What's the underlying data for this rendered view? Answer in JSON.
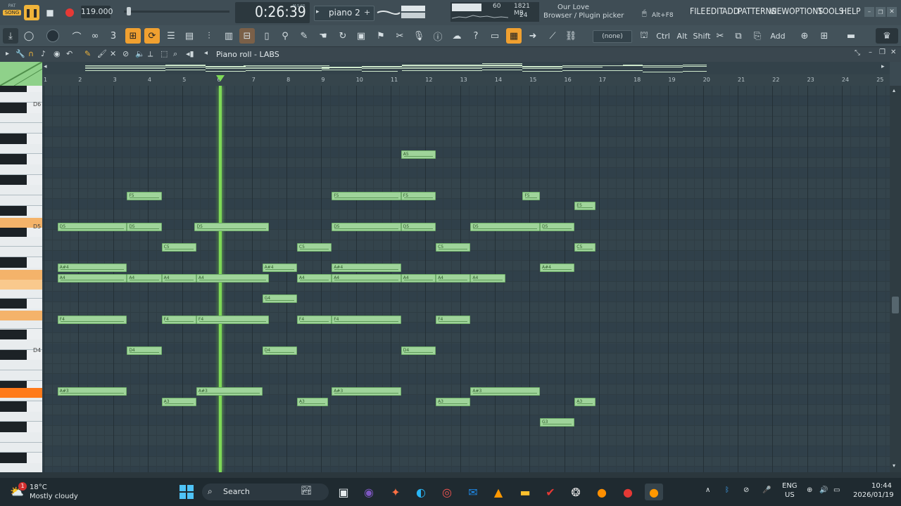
{
  "transport": {
    "song_label": "SONG",
    "pat_label": "PAT",
    "tempo": "119.000",
    "time": "0:26:39",
    "time_unit": "M:S:CS",
    "pattern_name": "piano 2",
    "cpu": "60",
    "memory": "1821 MB",
    "polyphony": "24"
  },
  "hint": {
    "line1": "Our Love",
    "line2": "Browser / Plugin picker",
    "shortcut": "Alt+F8"
  },
  "menu": [
    "FILE",
    "EDIT",
    "ADD",
    "PATTERNS",
    "VIEW",
    "OPTIONS",
    "TOOLS",
    "HELP"
  ],
  "toolbar2": {
    "channel_select": "(none)",
    "modifier_keys": [
      "Ctrl",
      "Alt",
      "Shift"
    ],
    "add_label": "Add"
  },
  "piano_roll": {
    "title": "Piano roll - LABS",
    "bars": [
      "1",
      "2",
      "3",
      "4",
      "5",
      "6",
      "7",
      "8",
      "9",
      "10",
      "11",
      "12",
      "13",
      "14",
      "15",
      "16",
      "17",
      "18",
      "19",
      "20",
      "21",
      "22",
      "23",
      "24",
      "25"
    ],
    "key_labels": [
      "D6",
      "D5",
      "D4"
    ],
    "playhead_bar": 6.05,
    "notes": [
      {
        "pitch": "A5",
        "start": 11.3,
        "len": 1.0,
        "row": 0
      },
      {
        "pitch": "F5",
        "start": 3.4,
        "len": 1.0,
        "row": 1
      },
      {
        "pitch": "F5",
        "start": 9.3,
        "len": 2.0,
        "row": 1
      },
      {
        "pitch": "F5",
        "start": 11.3,
        "len": 1.0,
        "row": 1
      },
      {
        "pitch": "F5",
        "start": 14.8,
        "len": 0.5,
        "row": 1
      },
      {
        "pitch": "E5",
        "start": 16.3,
        "len": 0.6,
        "row": 2
      },
      {
        "pitch": "D5",
        "start": 1.4,
        "len": 2.0,
        "row": 3
      },
      {
        "pitch": "D5",
        "start": 3.4,
        "len": 1.0,
        "row": 3
      },
      {
        "pitch": "D5",
        "start": 5.35,
        "len": 2.15,
        "row": 3
      },
      {
        "pitch": "D5",
        "start": 9.3,
        "len": 2.0,
        "row": 3
      },
      {
        "pitch": "D5",
        "start": 11.3,
        "len": 1.0,
        "row": 3
      },
      {
        "pitch": "D5",
        "start": 13.3,
        "len": 2.0,
        "row": 3
      },
      {
        "pitch": "D5",
        "start": 15.3,
        "len": 1.0,
        "row": 3
      },
      {
        "pitch": "C5",
        "start": 4.4,
        "len": 1.0,
        "row": 4
      },
      {
        "pitch": "C5",
        "start": 8.3,
        "len": 1.0,
        "row": 4
      },
      {
        "pitch": "C5",
        "start": 12.3,
        "len": 1.0,
        "row": 4
      },
      {
        "pitch": "C5",
        "start": 16.3,
        "len": 0.6,
        "row": 4
      },
      {
        "pitch": "A#4",
        "start": 1.4,
        "len": 2.0,
        "row": 5
      },
      {
        "pitch": "A#4",
        "start": 7.3,
        "len": 1.0,
        "row": 5
      },
      {
        "pitch": "A#4",
        "start": 9.3,
        "len": 2.0,
        "row": 5
      },
      {
        "pitch": "A#4",
        "start": 15.3,
        "len": 1.0,
        "row": 5
      },
      {
        "pitch": "A4",
        "start": 1.4,
        "len": 2.0,
        "row": 6
      },
      {
        "pitch": "A4",
        "start": 3.4,
        "len": 1.0,
        "row": 6
      },
      {
        "pitch": "A4",
        "start": 4.4,
        "len": 1.0,
        "row": 6
      },
      {
        "pitch": "A4",
        "start": 5.4,
        "len": 2.1,
        "row": 6
      },
      {
        "pitch": "A4",
        "start": 8.3,
        "len": 1.0,
        "row": 6
      },
      {
        "pitch": "A4",
        "start": 9.3,
        "len": 2.0,
        "row": 6
      },
      {
        "pitch": "A4",
        "start": 11.3,
        "len": 1.0,
        "row": 6
      },
      {
        "pitch": "A4",
        "start": 12.3,
        "len": 1.0,
        "row": 6
      },
      {
        "pitch": "A4",
        "start": 13.3,
        "len": 1.0,
        "row": 6
      },
      {
        "pitch": "G4",
        "start": 7.3,
        "len": 1.0,
        "row": 7
      },
      {
        "pitch": "F4",
        "start": 1.4,
        "len": 2.0,
        "row": 8
      },
      {
        "pitch": "F4",
        "start": 4.4,
        "len": 1.0,
        "row": 8
      },
      {
        "pitch": "F4",
        "start": 5.4,
        "len": 2.1,
        "row": 8
      },
      {
        "pitch": "F4",
        "start": 8.3,
        "len": 1.0,
        "row": 8
      },
      {
        "pitch": "F4",
        "start": 9.3,
        "len": 2.0,
        "row": 8
      },
      {
        "pitch": "F4",
        "start": 12.3,
        "len": 1.0,
        "row": 8
      },
      {
        "pitch": "D4",
        "start": 3.4,
        "len": 1.0,
        "row": 9
      },
      {
        "pitch": "D4",
        "start": 7.3,
        "len": 1.0,
        "row": 9
      },
      {
        "pitch": "D4",
        "start": 11.3,
        "len": 1.0,
        "row": 9
      },
      {
        "pitch": "A#3",
        "start": 1.4,
        "len": 2.0,
        "row": 10
      },
      {
        "pitch": "A#3",
        "start": 5.4,
        "len": 1.9,
        "row": 10
      },
      {
        "pitch": "A#3",
        "start": 9.3,
        "len": 2.0,
        "row": 10
      },
      {
        "pitch": "A#3",
        "start": 13.3,
        "len": 2.0,
        "row": 10
      },
      {
        "pitch": "A3",
        "start": 4.4,
        "len": 1.0,
        "row": 11
      },
      {
        "pitch": "A3",
        "start": 8.3,
        "len": 0.9,
        "row": 11
      },
      {
        "pitch": "A3",
        "start": 12.3,
        "len": 1.0,
        "row": 11
      },
      {
        "pitch": "A3",
        "start": 16.3,
        "len": 0.6,
        "row": 11
      },
      {
        "pitch": "G3",
        "start": 15.3,
        "len": 1.0,
        "row": 12
      }
    ]
  },
  "taskbar": {
    "weather_temp": "18°C",
    "weather_desc": "Mostly cloudy",
    "weather_badge": "1",
    "search_label": "Search",
    "lang_line1": "ENG",
    "lang_line2": "US",
    "clock_time": "10:44",
    "clock_date": "2026/01/19"
  },
  "colors": {
    "note_fill": "#9fd49a",
    "playhead": "#7ed957",
    "accent_orange": "#f0a030"
  }
}
